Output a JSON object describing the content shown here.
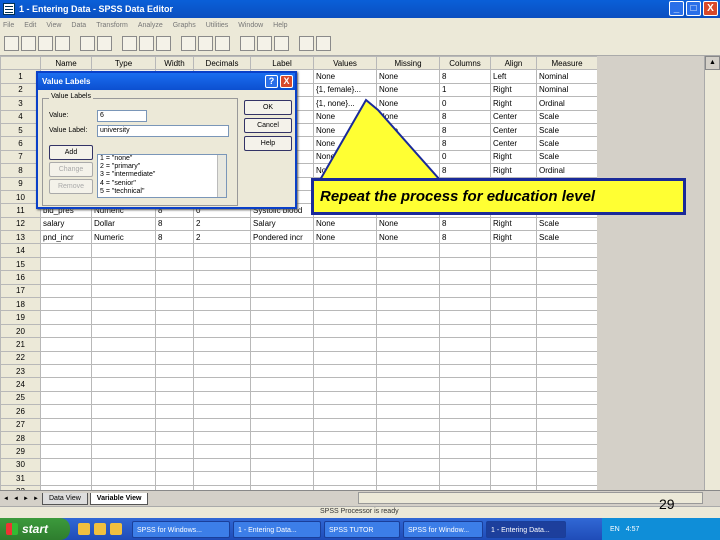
{
  "window": {
    "title": "1 - Entering Data - SPSS Data Editor",
    "min": "_",
    "max": "□",
    "close": "X"
  },
  "menu": [
    "File",
    "Edit",
    "View",
    "Data",
    "Transform",
    "Analyze",
    "Graphs",
    "Utilities",
    "Window",
    "Help"
  ],
  "grid": {
    "headers": [
      "Name",
      "Type",
      "Width",
      "Decimals",
      "Label",
      "Values",
      "Missing",
      "Columns",
      "Align",
      "Measure"
    ],
    "rows": [
      [
        "1",
        "",
        "",
        "",
        "",
        "Soc",
        "None",
        "None",
        "8",
        "Left",
        "Nominal"
      ],
      [
        "2",
        "",
        "",
        "",
        "",
        "",
        "{1, female}...",
        "None",
        "1",
        "Right",
        "Nominal"
      ],
      [
        "3",
        "",
        "",
        "",
        "",
        "ve",
        "{1, none}...",
        "None",
        "0",
        "Right",
        "Ordinal"
      ],
      [
        "4",
        "",
        "",
        "",
        "",
        "",
        "None",
        "None",
        "8",
        "Center",
        "Scale"
      ],
      [
        "5",
        "",
        "",
        "",
        "",
        "",
        "None",
        "None",
        "8",
        "Center",
        "Scale"
      ],
      [
        "6",
        "",
        "",
        "",
        "",
        "",
        "None",
        "None",
        "8",
        "Center",
        "Scale"
      ],
      [
        "7",
        "",
        "",
        "",
        "",
        "ntri",
        "None",
        "None",
        "0",
        "Right",
        "Scale"
      ],
      [
        "8",
        "",
        "",
        "",
        "",
        "",
        "None",
        "None",
        "8",
        "Right",
        "Ordinal"
      ],
      [
        "9",
        "",
        "",
        "",
        "",
        "",
        "",
        "",
        "",
        "",
        ""
      ],
      [
        "10",
        "",
        "",
        "",
        "",
        "",
        "",
        "",
        "",
        "",
        ""
      ],
      [
        "11",
        "bld_pres",
        "Numeric",
        "8",
        "0",
        "Systolic blood",
        "None",
        "None",
        "8",
        "Center",
        "Scale"
      ],
      [
        "12",
        "salary",
        "Dollar",
        "8",
        "2",
        "Salary",
        "None",
        "None",
        "8",
        "Right",
        "Scale"
      ],
      [
        "13",
        "pnd_incr",
        "Numeric",
        "8",
        "2",
        "Pondered incr",
        "None",
        "None",
        "8",
        "Right",
        "Scale"
      ],
      [
        "14",
        "",
        "",
        "",
        "",
        "",
        "",
        "",
        "",
        "",
        ""
      ],
      [
        "15",
        "",
        "",
        "",
        "",
        "",
        "",
        "",
        "",
        "",
        ""
      ],
      [
        "16",
        "",
        "",
        "",
        "",
        "",
        "",
        "",
        "",
        "",
        ""
      ],
      [
        "17",
        "",
        "",
        "",
        "",
        "",
        "",
        "",
        "",
        "",
        ""
      ],
      [
        "18",
        "",
        "",
        "",
        "",
        "",
        "",
        "",
        "",
        "",
        ""
      ],
      [
        "19",
        "",
        "",
        "",
        "",
        "",
        "",
        "",
        "",
        "",
        ""
      ],
      [
        "20",
        "",
        "",
        "",
        "",
        "",
        "",
        "",
        "",
        "",
        ""
      ],
      [
        "21",
        "",
        "",
        "",
        "",
        "",
        "",
        "",
        "",
        "",
        ""
      ],
      [
        "22",
        "",
        "",
        "",
        "",
        "",
        "",
        "",
        "",
        "",
        ""
      ],
      [
        "23",
        "",
        "",
        "",
        "",
        "",
        "",
        "",
        "",
        "",
        ""
      ],
      [
        "24",
        "",
        "",
        "",
        "",
        "",
        "",
        "",
        "",
        "",
        ""
      ],
      [
        "25",
        "",
        "",
        "",
        "",
        "",
        "",
        "",
        "",
        "",
        ""
      ],
      [
        "26",
        "",
        "",
        "",
        "",
        "",
        "",
        "",
        "",
        "",
        ""
      ],
      [
        "27",
        "",
        "",
        "",
        "",
        "",
        "",
        "",
        "",
        "",
        ""
      ],
      [
        "28",
        "",
        "",
        "",
        "",
        "",
        "",
        "",
        "",
        "",
        ""
      ],
      [
        "29",
        "",
        "",
        "",
        "",
        "",
        "",
        "",
        "",
        "",
        ""
      ],
      [
        "30",
        "",
        "",
        "",
        "",
        "",
        "",
        "",
        "",
        "",
        ""
      ],
      [
        "31",
        "",
        "",
        "",
        "",
        "",
        "",
        "",
        "",
        "",
        ""
      ],
      [
        "32",
        "",
        "",
        "",
        "",
        "",
        "",
        "",
        "",
        "",
        ""
      ]
    ]
  },
  "tabs": {
    "data_view": "Data View",
    "variable_view": "Variable View"
  },
  "status": "SPSS Processor is ready",
  "page_number": "29",
  "dialog": {
    "title": "Value Labels",
    "help_glyph": "?",
    "close_glyph": "X",
    "group_label": "Value Labels",
    "value_label": "Value:",
    "value": "6",
    "value_label_label": "Value Label:",
    "value_label_value": "university",
    "add": "Add",
    "change": "Change",
    "remove": "Remove",
    "ok": "OK",
    "cancel": "Cancel",
    "help": "Help",
    "list": [
      "1 = \"none\"",
      "2 = \"primary\"",
      "3 = \"intermediate\"",
      "4 = \"senior\"",
      "5 = \"technical\""
    ]
  },
  "callout": "Repeat the process for education level",
  "taskbar": {
    "start": "start",
    "tasks": [
      "SPSS for Windows...",
      "1 - Entering Data...",
      "SPSS TUTOR",
      "SPSS for Window...",
      "1 - Entering Data..."
    ],
    "tray": [
      "EN",
      "4:57"
    ]
  }
}
